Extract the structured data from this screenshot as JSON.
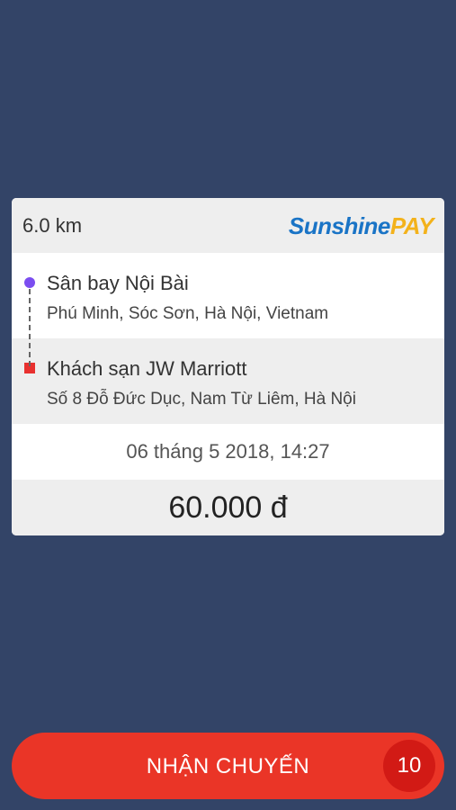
{
  "trip": {
    "distance": "6.0 km",
    "logo": {
      "part1": "Sunshine",
      "part2": "PAY"
    },
    "pickup": {
      "name": "Sân bay Nội Bài",
      "address": "Phú Minh, Sóc Sơn, Hà Nội, Vietnam"
    },
    "dropoff": {
      "name": "Khách sạn JW Marriott",
      "address": "Số 8 Đỗ Đức Dục, Nam Từ Liêm, Hà Nội"
    },
    "datetime": "06 tháng 5 2018, 14:27",
    "price": "60.000 đ"
  },
  "accept": {
    "label": "NHẬN CHUYẾN",
    "countdown": "10"
  },
  "colors": {
    "background": "#334467",
    "accent": "#ea3527",
    "pickup_dot": "#7b4df0",
    "dropoff_marker": "#e8312f",
    "logo_blue": "#1a74c6",
    "logo_yellow": "#f3b21b"
  }
}
